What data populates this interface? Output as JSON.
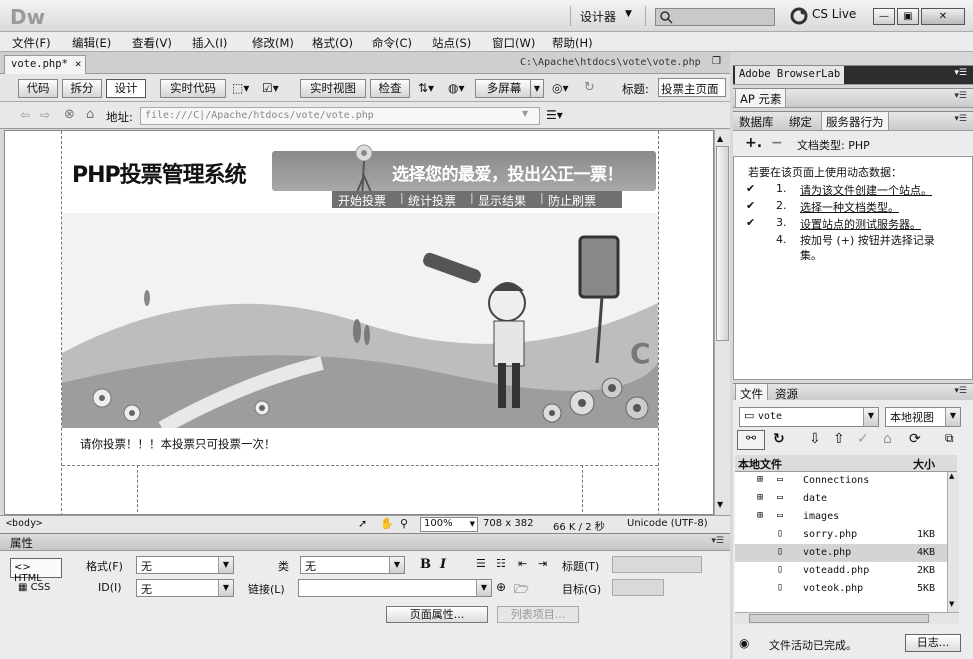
{
  "app": {
    "logo": "Dw",
    "workspace": "设计器",
    "cs_live": "CS Live"
  },
  "menu": [
    "文件(F)",
    "编辑(E)",
    "查看(V)",
    "插入(I)",
    "修改(M)",
    "格式(O)",
    "命令(C)",
    "站点(S)",
    "窗口(W)",
    "帮助(H)"
  ],
  "document": {
    "tab": "vote.php*",
    "path": "C:\\Apache\\htdocs\\vote\\vote.php"
  },
  "toolbar": {
    "code": "代码",
    "split": "拆分",
    "design": "设计",
    "live_code": "实时代码",
    "live_view": "实时视图",
    "inspect": "检查",
    "multiscreen": "多屏幕",
    "title_label": "标题:",
    "title_value": "投票主页面"
  },
  "address": {
    "label": "地址:",
    "value": "file:///C|/Apache/htdocs/vote/vote.php"
  },
  "page": {
    "heading": "PHP投票管理系统",
    "slogan": "选择您的最爱，投出公正一票！",
    "nav": [
      "开始投票",
      "统计投票",
      "显示结果",
      "防止刷票"
    ],
    "notice": "请你投票！！！本投票只可投票一次！"
  },
  "status": {
    "tag": "<body>",
    "zoom": "100%",
    "size": "708 x 382",
    "filesize": "66 K / 2 秒",
    "encoding": "Unicode (UTF-8)"
  },
  "properties": {
    "header": "属性",
    "html": "HTML",
    "css": "CSS",
    "format_label": "格式(F)",
    "format_value": "无",
    "id_label": "ID(I)",
    "id_value": "无",
    "class_label": "类",
    "class_value": "无",
    "link_label": "链接(L)",
    "title_label": "标题(T)",
    "target_label": "目标(G)",
    "page_props": "页面属性...",
    "list_item": "列表项目..."
  },
  "panels": {
    "browserlab": "Adobe BrowserLab",
    "ap": "AP 元素",
    "tabs": [
      "数据库",
      "绑定",
      "服务器行为"
    ],
    "doctype_label": "文档类型: PHP",
    "intro": "若要在该页面上使用动态数据：",
    "steps": [
      {
        "num": "1.",
        "text": "请为该文件创建一个站点。"
      },
      {
        "num": "2.",
        "text": "选择一种文档类型。"
      },
      {
        "num": "3.",
        "text": "设置站点的测试服务器。"
      },
      {
        "num": "4.",
        "text": "按加号 (+) 按钮并选择记录集。"
      }
    ]
  },
  "files": {
    "tabs": [
      "文件",
      "资源"
    ],
    "site": "vote",
    "view": "本地视图",
    "col_name": "本地文件",
    "col_size": "大小",
    "rows": [
      {
        "name": "Connections",
        "size": "",
        "folder": true
      },
      {
        "name": "date",
        "size": "",
        "folder": true
      },
      {
        "name": "images",
        "size": "",
        "folder": true
      },
      {
        "name": "sorry.php",
        "size": "1KB",
        "folder": false
      },
      {
        "name": "vote.php",
        "size": "4KB",
        "folder": false
      },
      {
        "name": "voteadd.php",
        "size": "2KB",
        "folder": false
      },
      {
        "name": "voteok.php",
        "size": "5KB",
        "folder": false
      }
    ],
    "status": "文件活动已完成。",
    "log": "日志..."
  }
}
